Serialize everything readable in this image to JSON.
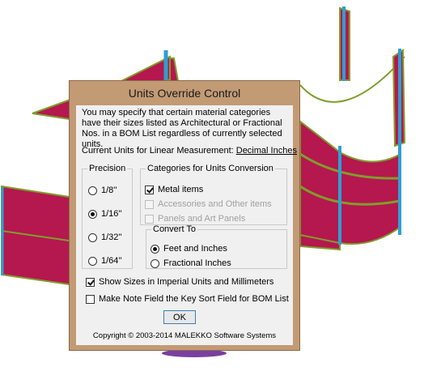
{
  "dialog": {
    "title": "Units Override Control",
    "intro": "You may specify that certain material categories have their sizes listed as Architectural or Fractional Nos. in a BOM List regardless of currently selected units.",
    "units_label": "Current Units for Linear Measurement:",
    "units_value": "Decimal Inches",
    "precision": {
      "legend": "Precision",
      "options": [
        "1/8''",
        "1/16''",
        "1/32''",
        "1/64''"
      ],
      "selected": "1/16''"
    },
    "categories": {
      "legend": "Categories for Units Conversion",
      "items": [
        {
          "label": "Metal items",
          "checked": true,
          "enabled": true
        },
        {
          "label": "Accessories and Other items",
          "checked": false,
          "enabled": false
        },
        {
          "label": "Panels and Art Panels",
          "checked": false,
          "enabled": false
        }
      ]
    },
    "convert_to": {
      "legend": "Convert To",
      "options": [
        "Feet and Inches",
        "Fractional Inches"
      ],
      "selected": "Feet and Inches"
    },
    "show_sizes": {
      "label": "Show Sizes in Imperial Units and Millimeters",
      "checked": true
    },
    "note_field": {
      "label": "Make Note Field the Key Sort Field for BOM List",
      "checked": false
    },
    "ok_label": "OK",
    "copyright": "Copyright © 2003-2014  MALEKKO Software Systems"
  },
  "colors": {
    "panel_red": "#b5174f",
    "panel_edge_green": "#7f9e2a",
    "post_blue": "#2f9fd3",
    "dialog_frame": "#c29a74",
    "focus_blue": "#3c7fb1"
  }
}
